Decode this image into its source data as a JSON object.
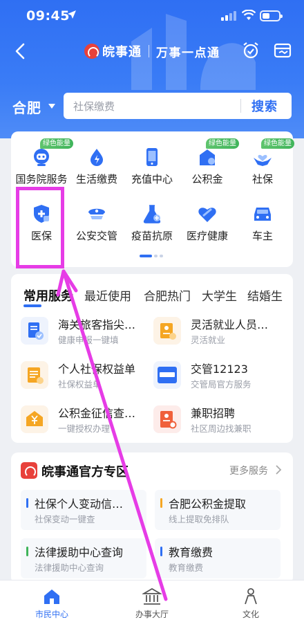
{
  "status": {
    "time": "09:45"
  },
  "nav": {
    "app_name": "皖事通",
    "slogan": "万事一点通"
  },
  "search": {
    "city": "合肥",
    "placeholder": "社保缴费",
    "button": "搜索"
  },
  "services": [
    {
      "label": "国务院服务",
      "icon": "robot-icon",
      "badge": "绿色能量"
    },
    {
      "label": "生活缴费",
      "icon": "water-drop-icon",
      "badge": ""
    },
    {
      "label": "充值中心",
      "icon": "phone-icon",
      "badge": ""
    },
    {
      "label": "公积金",
      "icon": "house-fund-icon",
      "badge": "绿色能量"
    },
    {
      "label": "社保",
      "icon": "hands-heart-icon",
      "badge": "绿色能量"
    },
    {
      "label": "医保",
      "icon": "medical-shield-icon",
      "badge": ""
    },
    {
      "label": "公安交管",
      "icon": "police-cap-icon",
      "badge": ""
    },
    {
      "label": "疫苗抗原",
      "icon": "flask-icon",
      "badge": ""
    },
    {
      "label": "医疗健康",
      "icon": "heart-icon",
      "badge": ""
    },
    {
      "label": "车主",
      "icon": "car-icon",
      "badge": ""
    }
  ],
  "tabs": [
    "常用服务",
    "最近使用",
    "合肥热门",
    "大学生",
    "结婚生"
  ],
  "common": [
    {
      "title": "海关旅客指尖…",
      "sub": "健康申报一键填"
    },
    {
      "title": "灵活就业人员…",
      "sub": "灵活就业"
    },
    {
      "title": "个人社保权益单",
      "sub": "社保权益单"
    },
    {
      "title": "交管12123",
      "sub": "交管局官方服务"
    },
    {
      "title": "公积金征信查…",
      "sub": "一键授权办理"
    },
    {
      "title": "兼职招聘",
      "sub": "社区周边找兼职"
    }
  ],
  "zone": {
    "title": "皖事通官方专区",
    "more": "更多服务",
    "items": [
      {
        "title": "社保个人变动信…",
        "sub": "社保变动一键查",
        "color": "#2f6ff3"
      },
      {
        "title": "合肥公积金提取",
        "sub": "线上提取免排队",
        "color": "#f5a623"
      },
      {
        "title": "法律援助中心查询",
        "sub": "法律援助中心查询",
        "color": "#3fb45a"
      },
      {
        "title": "教育缴费",
        "sub": "教育缴费",
        "color": "#2f6ff3"
      }
    ]
  },
  "tabbar": [
    {
      "label": "市民中心",
      "icon": "home-icon"
    },
    {
      "label": "办事大厅",
      "icon": "government-hall-icon"
    },
    {
      "label": "文化",
      "icon": "person-icon"
    }
  ],
  "colors": {
    "primary": "#2f6ff3",
    "annotation": "#e63ce6",
    "badge": "#3fb45a"
  }
}
